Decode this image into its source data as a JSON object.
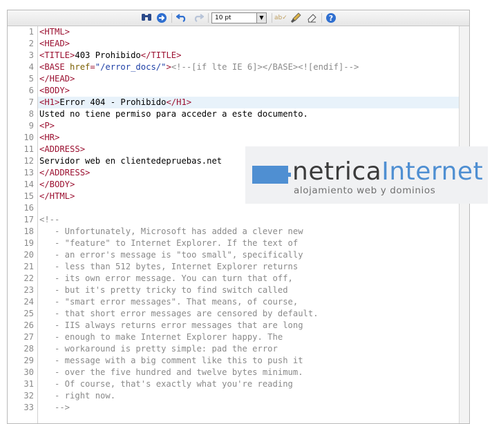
{
  "toolbar": {
    "font_size_value": "10 pt",
    "icons": [
      "binoculars-icon",
      "navigate-icon",
      "undo-icon",
      "redo-icon",
      "spellcheck-icon",
      "brush-icon",
      "eraser-icon",
      "help-icon"
    ]
  },
  "editor": {
    "highlighted_line": 7,
    "line_numbers": [
      "1",
      "2",
      "3",
      "4",
      "5",
      "6",
      "7",
      "8",
      "9",
      "10",
      "11",
      "12",
      "13",
      "14",
      "15",
      "16",
      "17",
      "18",
      "19",
      "20",
      "21",
      "22",
      "23",
      "24",
      "25",
      "26",
      "27",
      "28",
      "29",
      "30",
      "31",
      "32",
      "33"
    ],
    "lines": [
      [
        [
          "tag",
          "<HTML>"
        ]
      ],
      [
        [
          "tag",
          "<HEAD>"
        ]
      ],
      [
        [
          "tag",
          "<TITLE>"
        ],
        [
          "txt",
          "403 Prohibido"
        ],
        [
          "tag",
          "</TITLE>"
        ]
      ],
      [
        [
          "tag",
          "<BASE "
        ],
        [
          "attr",
          "href"
        ],
        [
          "tag",
          "="
        ],
        [
          "str",
          "\"/error_docs/\""
        ],
        [
          "tag",
          ">"
        ],
        [
          "cmt",
          "<!--[if lte IE 6]></BASE><![endif]-->"
        ]
      ],
      [
        [
          "tag",
          "</HEAD>"
        ]
      ],
      [
        [
          "tag",
          "<BODY>"
        ]
      ],
      [
        [
          "tag",
          "<H1>"
        ],
        [
          "txt",
          "Error 404 - Prohibido"
        ],
        [
          "tag",
          "</H1>"
        ]
      ],
      [
        [
          "txt",
          "Usted no tiene permiso para acceder a este documento."
        ]
      ],
      [
        [
          "tag",
          "<P>"
        ]
      ],
      [
        [
          "tag",
          "<HR>"
        ]
      ],
      [
        [
          "tag",
          "<ADDRESS>"
        ]
      ],
      [
        [
          "txt",
          "Servidor web en clientedepruebas.net"
        ]
      ],
      [
        [
          "tag",
          "</ADDRESS>"
        ]
      ],
      [
        [
          "tag",
          "</BODY>"
        ]
      ],
      [
        [
          "tag",
          "</HTML>"
        ]
      ],
      [],
      [
        [
          "cmt",
          "<!--"
        ]
      ],
      [
        [
          "cmt",
          "   - Unfortunately, Microsoft has added a clever new"
        ]
      ],
      [
        [
          "cmt",
          "   - \"feature\" to Internet Explorer. If the text of"
        ]
      ],
      [
        [
          "cmt",
          "   - an error's message is \"too small\", specifically"
        ]
      ],
      [
        [
          "cmt",
          "   - less than 512 bytes, Internet Explorer returns"
        ]
      ],
      [
        [
          "cmt",
          "   - its own error message. You can turn that off,"
        ]
      ],
      [
        [
          "cmt",
          "   - but it's pretty tricky to find switch called"
        ]
      ],
      [
        [
          "cmt",
          "   - \"smart error messages\". That means, of course,"
        ]
      ],
      [
        [
          "cmt",
          "   - that short error messages are censored by default."
        ]
      ],
      [
        [
          "cmt",
          "   - IIS always returns error messages that are long"
        ]
      ],
      [
        [
          "cmt",
          "   - enough to make Internet Explorer happy. The"
        ]
      ],
      [
        [
          "cmt",
          "   - workaround is pretty simple: pad the error"
        ]
      ],
      [
        [
          "cmt",
          "   - message with a big comment like this to push it"
        ]
      ],
      [
        [
          "cmt",
          "   - over the five hundred and twelve bytes minimum."
        ]
      ],
      [
        [
          "cmt",
          "   - Of course, that's exactly what you're reading"
        ]
      ],
      [
        [
          "cmt",
          "   - right now."
        ]
      ],
      [
        [
          "cmt",
          "   -->"
        ]
      ]
    ]
  },
  "logo": {
    "name_part1": "netrica",
    "name_part2": "Internet",
    "tagline": "alojamiento web y dominios",
    "accent_color": "#4f8fd2"
  }
}
